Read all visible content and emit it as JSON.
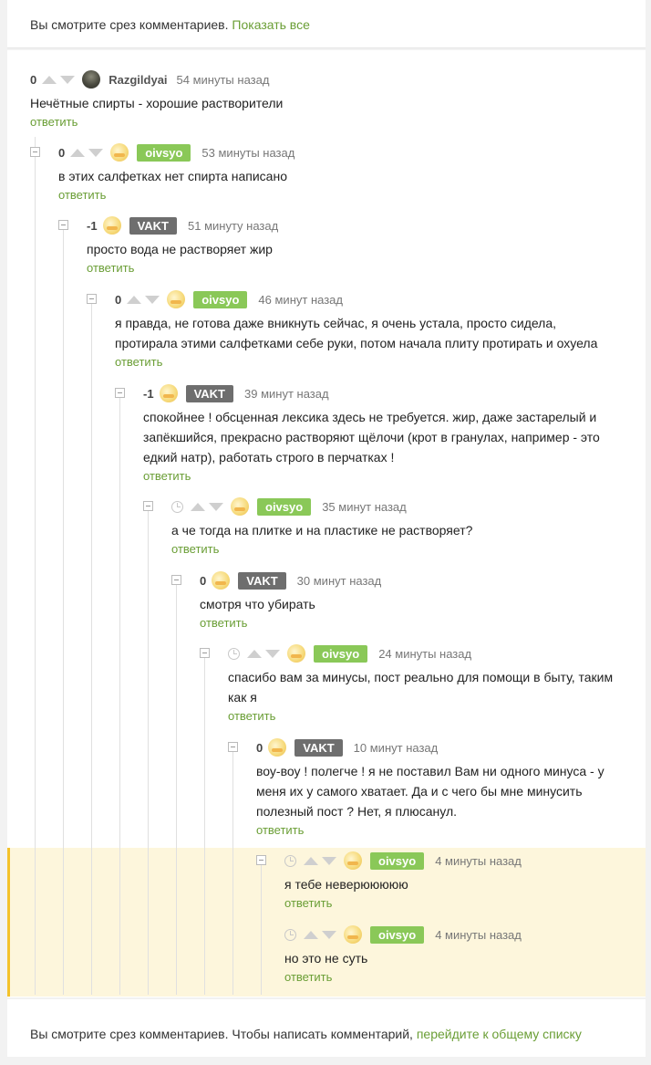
{
  "top_notice": {
    "text": "Вы смотрите срез комментариев. ",
    "link": "Показать все"
  },
  "bottom_notice": {
    "text": "Вы смотрите срез комментариев. Чтобы написать комментарий, ",
    "link": "перейдите к общему списку"
  },
  "reply_label": "ответить",
  "colors": {
    "link": "#6a9e35",
    "badge_author": "#8ac858",
    "badge_grey": "#6e6e6e",
    "highlight": "#fdf6dc",
    "highlight_border": "#f4c22b"
  },
  "comments": [
    {
      "rating": "0",
      "user": "Razgildyai",
      "time": "54 минуты назад",
      "lines": [
        "Нечётные спирты - хорошие растворители"
      ]
    },
    {
      "rating": "0",
      "user": "oivsyo",
      "time": "53 минуты назад",
      "lines": [
        "в этих салфетках нет спирта написано"
      ]
    },
    {
      "rating": "-1",
      "user": "VAKT",
      "time": "51 минуту назад",
      "lines": [
        "просто вода не растворяет жир"
      ]
    },
    {
      "rating": "0",
      "user": "oivsyo",
      "time": "46 минут назад",
      "lines": [
        "я правда, не готова даже вникнуть сейчас, я очень устала, просто сидела,",
        "протирала этими салфетками себе руки, потом начала плиту протирать и охуела"
      ]
    },
    {
      "rating": "-1",
      "user": "VAKT",
      "time": "39 минут назад",
      "lines": [
        "спокойнее ! обсценная лексика здесь не требуется. жир, даже застарелый и",
        "запёкшийся, прекрасно растворяют щёлочи (крот в гранулах, например - это",
        "едкий натр), работать строго в перчатках !"
      ]
    },
    {
      "rating": "",
      "user": "oivsyo",
      "time": "35 минут назад",
      "lines": [
        "а че тогда на плитке и на пластике не растворяет?"
      ]
    },
    {
      "rating": "0",
      "user": "VAKT",
      "time": "30 минут назад",
      "lines": [
        "смотря что убирать"
      ]
    },
    {
      "rating": "",
      "user": "oivsyo",
      "time": "24 минуты назад",
      "lines": [
        "спасибо вам за минусы, пост реально для помощи в быту, таким",
        "как я"
      ]
    },
    {
      "rating": "0",
      "user": "VAKT",
      "time": "10 минут назад",
      "lines": [
        "воу-воу ! полегче ! я не поставил Вам ни одного минуса - у",
        "меня их у самого хватает. Да и с чего бы мне минусить",
        "полезный пост ? Нет, я плюсанул."
      ]
    },
    {
      "rating": "",
      "user": "oivsyo",
      "time": "4 минуты назад",
      "lines": [
        "я тебе неверююююю"
      ]
    },
    {
      "rating": "",
      "user": "oivsyo",
      "time": "4 минуты назад",
      "lines": [
        "но это не суть"
      ]
    }
  ]
}
